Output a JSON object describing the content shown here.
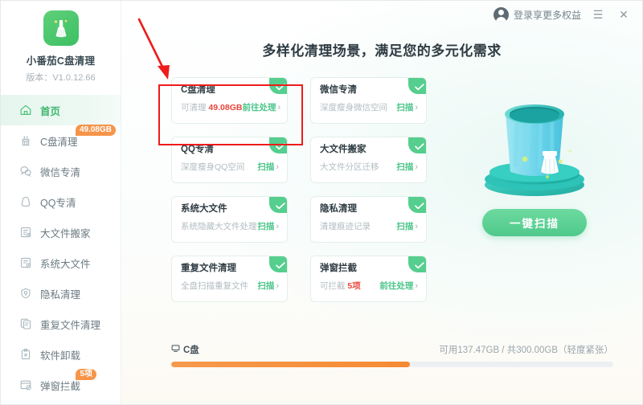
{
  "app": {
    "logo_icon": "broom-logo-icon",
    "name": "小番茄C盘清理",
    "version": "版本：V1.0.12.66"
  },
  "topbar": {
    "account_icon": "user-avatar-icon",
    "account_label": "登录享更多权益",
    "menu_icon": "hamburger-menu-icon",
    "menu_glyph": "☰",
    "close_icon": "close-icon",
    "close_glyph": "✕"
  },
  "main": {
    "title": "多样化清理场景，满足您的多元化需求",
    "illustration_icon": "trash-bin-illustration",
    "scan_button": "一键扫描"
  },
  "sidebar": {
    "items": [
      {
        "label": "首页",
        "icon": "home-icon",
        "active": true,
        "badge": ""
      },
      {
        "label": "C盘清理",
        "icon": "broom-icon",
        "active": false,
        "badge": "49.08GB"
      },
      {
        "label": "微信专清",
        "icon": "wechat-icon",
        "active": false,
        "badge": ""
      },
      {
        "label": "QQ专清",
        "icon": "qq-penguin-icon",
        "active": false,
        "badge": ""
      },
      {
        "label": "大文件搬家",
        "icon": "file-move-icon",
        "active": false,
        "badge": ""
      },
      {
        "label": "系统大文件",
        "icon": "system-file-icon",
        "active": false,
        "badge": ""
      },
      {
        "label": "隐私清理",
        "icon": "shield-privacy-icon",
        "active": false,
        "badge": ""
      },
      {
        "label": "重复文件清理",
        "icon": "duplicate-file-icon",
        "active": false,
        "badge": ""
      },
      {
        "label": "软件卸载",
        "icon": "uninstall-icon",
        "active": false,
        "badge": ""
      },
      {
        "label": "弹窗拦截",
        "icon": "popup-block-icon",
        "active": false,
        "badge": "5项"
      }
    ]
  },
  "cards": [
    {
      "title": "C盘清理",
      "desc_prefix": "可清理 ",
      "desc_highlight": "49.08GB",
      "action": "前往处理",
      "chevron": "›",
      "checked": true,
      "highlighted": true
    },
    {
      "title": "微信专清",
      "desc_prefix": "深度瘦身微信空间",
      "desc_highlight": "",
      "action": "扫描",
      "chevron": "›",
      "checked": true,
      "highlighted": false
    },
    {
      "title": "QQ专清",
      "desc_prefix": "深度瘦身QQ空间",
      "desc_highlight": "",
      "action": "扫描",
      "chevron": "›",
      "checked": true,
      "highlighted": false
    },
    {
      "title": "大文件搬家",
      "desc_prefix": "大文件分区迁移",
      "desc_highlight": "",
      "action": "扫描",
      "chevron": "›",
      "checked": true,
      "highlighted": false
    },
    {
      "title": "系统大文件",
      "desc_prefix": "系统隐藏大文件处理",
      "desc_highlight": "",
      "action": "扫描",
      "chevron": "›",
      "checked": true,
      "highlighted": false
    },
    {
      "title": "隐私清理",
      "desc_prefix": "清理痕迹记录",
      "desc_highlight": "",
      "action": "扫描",
      "chevron": "›",
      "checked": true,
      "highlighted": false
    },
    {
      "title": "重复文件清理",
      "desc_prefix": "全盘扫描重复文件",
      "desc_highlight": "",
      "action": "扫描",
      "chevron": "›",
      "checked": true,
      "highlighted": false
    },
    {
      "title": "弹窗拦截",
      "desc_prefix": "可拦截 ",
      "desc_highlight": "5项",
      "action": "前往处理",
      "chevron": "›",
      "checked": true,
      "highlighted": false
    }
  ],
  "disk": {
    "icon": "disk-drive-icon",
    "name": "C盘",
    "info": "可用137.47GB / 共300.00GB（轻度紧张）",
    "used_percent": 54
  },
  "colors": {
    "accent_green": "#4cc58a",
    "badge_orange": "#f6954a",
    "bar_orange": "#f58a33",
    "highlight_red": "#e8453c",
    "annotation_red": "#ee1c1c"
  },
  "annotations": {
    "arrow_icon": "red-arrow-annotation",
    "rect_icon": "red-rectangle-annotation"
  }
}
